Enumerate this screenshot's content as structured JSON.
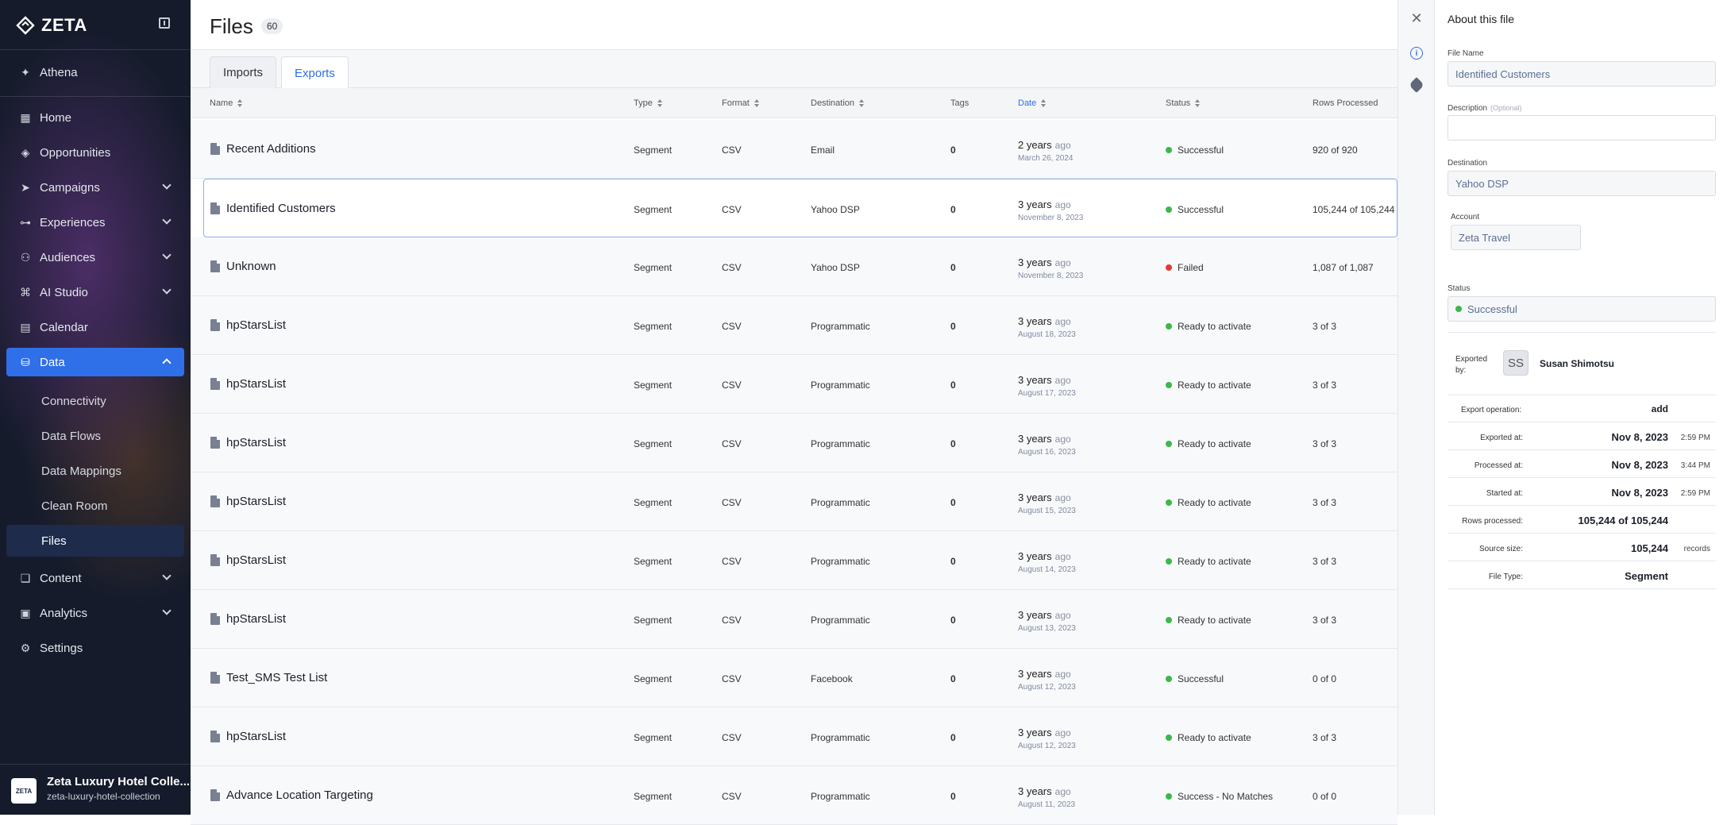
{
  "sidebar": {
    "brand": "ZETA",
    "items": [
      {
        "label": "Athena",
        "icon": "sparkle-icon"
      },
      {
        "label": "Home",
        "icon": "grid-icon"
      },
      {
        "label": "Opportunities",
        "icon": "diamond-icon"
      },
      {
        "label": "Campaigns",
        "icon": "send-icon"
      },
      {
        "label": "Experiences",
        "icon": "hierarchy-icon"
      },
      {
        "label": "Audiences",
        "icon": "people-icon"
      },
      {
        "label": "AI Studio",
        "icon": "ai-icon"
      },
      {
        "label": "Calendar",
        "icon": "calendar-icon"
      },
      {
        "label": "Data",
        "icon": "database-icon"
      },
      {
        "label": "Content",
        "icon": "content-icon"
      },
      {
        "label": "Analytics",
        "icon": "analytics-icon"
      },
      {
        "label": "Settings",
        "icon": "gear-icon"
      }
    ],
    "data_sub": [
      "Connectivity",
      "Data Flows",
      "Data Mappings",
      "Clean Room",
      "Files"
    ],
    "org_badge": "ZETA",
    "org_name": "Zeta Luxury Hotel Colle...",
    "org_slug": "zeta-luxury-hotel-collection"
  },
  "main": {
    "title": "Files",
    "count": "60",
    "tabs": [
      "Imports",
      "Exports"
    ],
    "active_tab": "Exports",
    "columns": [
      "Name",
      "Type",
      "Format",
      "Destination",
      "Tags",
      "Date",
      "Status",
      "Rows Processed"
    ],
    "rows": [
      {
        "name": "Recent Additions",
        "type": "Segment",
        "format": "CSV",
        "destination": "Email",
        "tags": "0",
        "date": "2 years",
        "ago": "ago",
        "date_sub": "March 26, 2024",
        "status": "Successful",
        "rows": "920 of 920"
      },
      {
        "name": "Identified Customers",
        "type": "Segment",
        "format": "CSV",
        "destination": "Yahoo DSP",
        "tags": "0",
        "date": "3 years",
        "ago": "ago",
        "date_sub": "November 8, 2023",
        "status": "Successful",
        "rows": "105,244 of 105,244"
      },
      {
        "name": "Unknown",
        "type": "Segment",
        "format": "CSV",
        "destination": "Yahoo DSP",
        "tags": "0",
        "date": "3 years",
        "ago": "ago",
        "date_sub": "November 8, 2023",
        "status": "Failed",
        "rows": "1,087 of 1,087"
      },
      {
        "name": "hpStarsList",
        "type": "Segment",
        "format": "CSV",
        "destination": "Programmatic",
        "tags": "0",
        "date": "3 years",
        "ago": "ago",
        "date_sub": "August 18, 2023",
        "status": "Ready to activate",
        "rows": "3 of 3"
      },
      {
        "name": "hpStarsList",
        "type": "Segment",
        "format": "CSV",
        "destination": "Programmatic",
        "tags": "0",
        "date": "3 years",
        "ago": "ago",
        "date_sub": "August 17, 2023",
        "status": "Ready to activate",
        "rows": "3 of 3"
      },
      {
        "name": "hpStarsList",
        "type": "Segment",
        "format": "CSV",
        "destination": "Programmatic",
        "tags": "0",
        "date": "3 years",
        "ago": "ago",
        "date_sub": "August 16, 2023",
        "status": "Ready to activate",
        "rows": "3 of 3"
      },
      {
        "name": "hpStarsList",
        "type": "Segment",
        "format": "CSV",
        "destination": "Programmatic",
        "tags": "0",
        "date": "3 years",
        "ago": "ago",
        "date_sub": "August 15, 2023",
        "status": "Ready to activate",
        "rows": "3 of 3"
      },
      {
        "name": "hpStarsList",
        "type": "Segment",
        "format": "CSV",
        "destination": "Programmatic",
        "tags": "0",
        "date": "3 years",
        "ago": "ago",
        "date_sub": "August 14, 2023",
        "status": "Ready to activate",
        "rows": "3 of 3"
      },
      {
        "name": "hpStarsList",
        "type": "Segment",
        "format": "CSV",
        "destination": "Programmatic",
        "tags": "0",
        "date": "3 years",
        "ago": "ago",
        "date_sub": "August 13, 2023",
        "status": "Ready to activate",
        "rows": "3 of 3"
      },
      {
        "name": "Test_SMS Test List",
        "type": "Segment",
        "format": "CSV",
        "destination": "Facebook",
        "tags": "0",
        "date": "3 years",
        "ago": "ago",
        "date_sub": "August 12, 2023",
        "status": "Successful",
        "rows": "0 of 0"
      },
      {
        "name": "hpStarsList",
        "type": "Segment",
        "format": "CSV",
        "destination": "Programmatic",
        "tags": "0",
        "date": "3 years",
        "ago": "ago",
        "date_sub": "August 12, 2023",
        "status": "Ready to activate",
        "rows": "3 of 3"
      },
      {
        "name": "Advance Location Targeting",
        "type": "Segment",
        "format": "CSV",
        "destination": "Programmatic",
        "tags": "0",
        "date": "3 years",
        "ago": "ago",
        "date_sub": "August 11, 2023",
        "status": "Success - No Matches",
        "rows": "0 of 0"
      }
    ]
  },
  "panel": {
    "title": "About this file",
    "file_name_label": "File Name",
    "file_name": "Identified Customers",
    "description_label": "Description",
    "description_optional": "(Optional)",
    "description": "",
    "destination_label": "Destination",
    "destination": "Yahoo DSP",
    "account_label": "Account",
    "account": "Zeta Travel",
    "status_label": "Status",
    "status": "Successful",
    "exported_by_label": "Exported by:",
    "exported_by_initials": "SS",
    "exported_by": "Susan Shimotsu",
    "details": [
      {
        "label": "Export operation:",
        "value": "add",
        "extra": ""
      },
      {
        "label": "Exported at:",
        "value": "Nov 8, 2023",
        "extra": "2:59 PM"
      },
      {
        "label": "Processed at:",
        "value": "Nov 8, 2023",
        "extra": "3:44 PM"
      },
      {
        "label": "Started at:",
        "value": "Nov 8, 2023",
        "extra": "2:59 PM"
      },
      {
        "label": "Rows processed:",
        "value": "105,244 of 105,244",
        "extra": ""
      },
      {
        "label": "Source size:",
        "value": "105,244",
        "extra": "records"
      },
      {
        "label": "File Type:",
        "value": "Segment",
        "extra": ""
      }
    ]
  },
  "colors": {
    "accent": "#2f6fe8",
    "success": "#3cb84a",
    "failed": "#e53935",
    "sidebar_bg": "#151b2b"
  }
}
